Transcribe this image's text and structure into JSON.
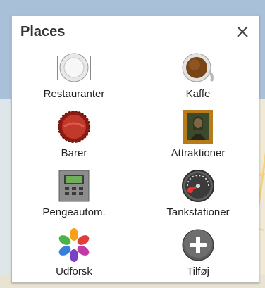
{
  "dialog": {
    "title": "Places"
  },
  "items": [
    {
      "label": "Restauranter",
      "icon": "restaurant-plate-icon"
    },
    {
      "label": "Kaffe",
      "icon": "coffee-cup-icon"
    },
    {
      "label": "Barer",
      "icon": "bottle-cap-icon"
    },
    {
      "label": "Attraktioner",
      "icon": "mona-lisa-painting-icon"
    },
    {
      "label": "Pengeautom.",
      "icon": "atm-machine-icon"
    },
    {
      "label": "Tankstationer",
      "icon": "fuel-gauge-icon"
    },
    {
      "label": "Udforsk",
      "icon": "flower-icon"
    },
    {
      "label": "Tilføj",
      "icon": "add-plus-icon"
    }
  ]
}
